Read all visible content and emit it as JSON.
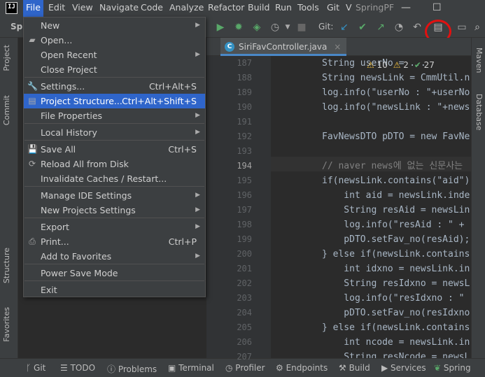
{
  "app": {
    "logo_text": "IJ",
    "project_partial": "SpringPF",
    "project_tool_label": "Spr"
  },
  "menubar": {
    "items": [
      "File",
      "Edit",
      "View",
      "Navigate",
      "Code",
      "Analyze",
      "Refactor",
      "Build",
      "Run",
      "Tools",
      "Git",
      "V"
    ],
    "window_controls": [
      "—",
      "☐"
    ]
  },
  "toolbar": {
    "git_label": "Git:"
  },
  "file_menu": {
    "items": [
      {
        "label": "New",
        "submenu": true
      },
      {
        "label": "Open...",
        "icon": "folder-open-icon"
      },
      {
        "label": "Open Recent",
        "submenu": true
      },
      {
        "label": "Close Project"
      },
      {
        "label": "Settings...",
        "shortcut": "Ctrl+Alt+S",
        "icon": "wrench-icon"
      },
      {
        "label": "Project Structure...",
        "shortcut": "Ctrl+Alt+Shift+S",
        "icon": "project-structure-icon",
        "selected": true
      },
      {
        "label": "File Properties",
        "submenu": true
      },
      {
        "label": "Local History",
        "submenu": true
      },
      {
        "label": "Save All",
        "shortcut": "Ctrl+S",
        "icon": "save-icon"
      },
      {
        "label": "Reload All from Disk",
        "icon": "reload-icon"
      },
      {
        "label": "Invalidate Caches / Restart..."
      },
      {
        "label": "Manage IDE Settings",
        "submenu": true
      },
      {
        "label": "New Projects Settings",
        "submenu": true
      },
      {
        "label": "Export",
        "submenu": true
      },
      {
        "label": "Print...",
        "shortcut": "Ctrl+P",
        "icon": "printer-icon"
      },
      {
        "label": "Add to Favorites",
        "submenu": true
      },
      {
        "label": "Power Save Mode"
      },
      {
        "label": "Exit"
      }
    ]
  },
  "editor": {
    "tab_label": "SiriFavController.java",
    "inspections": {
      "warnings": "10",
      "weak_warnings": "2",
      "ok": "27"
    },
    "current_line": "194",
    "lines": [
      {
        "num": "187",
        "code": "String userNo = ..."
      },
      {
        "num": "188",
        "code": "String newsLink = CmmUtil.n"
      },
      {
        "num": "189",
        "code": "log.info(\"userNo : \"+userNo"
      },
      {
        "num": "190",
        "code": "log.info(\"newsLink : \"+news"
      },
      {
        "num": "191",
        "code": ""
      },
      {
        "num": "192",
        "code": "FavNewsDTO pDTO = new FavNe"
      },
      {
        "num": "193",
        "code": ""
      },
      {
        "num": "194",
        "code": "// naver news에 없는 신문사는"
      },
      {
        "num": "195",
        "code": "if(newsLink.contains(\"aid\")"
      },
      {
        "num": "196",
        "code": "    int aid = newsLink.inde"
      },
      {
        "num": "197",
        "code": "    String resAid = newsLin"
      },
      {
        "num": "198",
        "code": "    log.info(\"resAid : \" +"
      },
      {
        "num": "199",
        "code": "    pDTO.setFav_no(resAid);"
      },
      {
        "num": "200",
        "code": "} else if(newsLink.contains"
      },
      {
        "num": "201",
        "code": "    int idxno = newsLink.in"
      },
      {
        "num": "202",
        "code": "    String resIdxno = newsL"
      },
      {
        "num": "203",
        "code": "    log.info(\"resIdxno : \""
      },
      {
        "num": "204",
        "code": "    pDTO.setFav_no(resIdxno"
      },
      {
        "num": "205",
        "code": "} else if(newsLink.contains"
      },
      {
        "num": "206",
        "code": "    int ncode = newsLink.in"
      },
      {
        "num": "207",
        "code": "    String resNcode = newsL"
      }
    ]
  },
  "left_tabs": [
    "Project",
    "Commit",
    "Structure",
    "Favorites"
  ],
  "right_tabs": [
    "Maven",
    "Database"
  ],
  "bottom_tabs": [
    "Git",
    "TODO",
    "Problems",
    "Terminal",
    "Profiler",
    "Endpoints",
    "Build",
    "Services",
    "Spring"
  ],
  "colors": {
    "accent": "#2f65ca",
    "highlight_circle": "#e31010",
    "menu_bg": "#3c3f41",
    "editor_bg": "#2b2b2b"
  }
}
